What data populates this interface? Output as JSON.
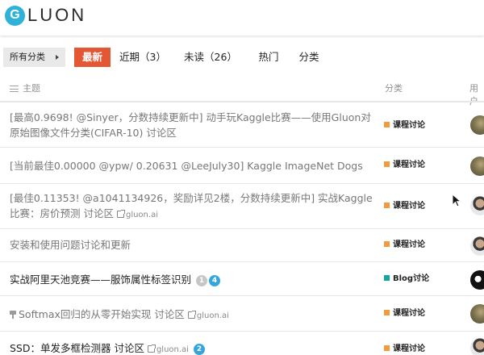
{
  "brand": {
    "logo_letter": "G",
    "logo_text": "LUON"
  },
  "nav": {
    "category_dropdown": "所有分类",
    "tabs": [
      {
        "label": "最新",
        "active": true
      },
      {
        "label": "近期（3）",
        "active": false
      },
      {
        "label": "未读（26）",
        "active": false
      },
      {
        "label": "热门",
        "active": false
      },
      {
        "label": "分类",
        "active": false
      }
    ]
  },
  "table": {
    "headers": {
      "topic": "主题",
      "category": "分类",
      "users": "用户"
    },
    "rows": [
      {
        "title": "[最高0.9698! @Sinyer，分数持续更新中] 动手玩Kaggle比赛——使用Gluon对原始图像文件分类(CIFAR-10) 讨论区",
        "unread": false,
        "category": "课程讨论",
        "category_color": "#f19a3e",
        "avatar": "olive"
      },
      {
        "title": "[当前最佳0.00000 @ypw/ 0.20631 @LeeJuly30] Kaggle ImageNet Dogs",
        "unread": false,
        "category": "课程讨论",
        "category_color": "#f19a3e",
        "avatar": "olive"
      },
      {
        "title": "[最佳0.11353! @a1041134926，奖励详见2楼，分数持续更新中] 实战Kaggle比赛：房价预测 讨论区",
        "ext_link": "gluon.ai",
        "unread": false,
        "category": "课程讨论",
        "category_color": "#f19a3e",
        "avatar": "person"
      },
      {
        "title": "安装和使用问题讨论和更新",
        "unread": false,
        "category": "课程讨论",
        "category_color": "#f19a3e",
        "avatar": "person"
      },
      {
        "title": "实战阿里天池竞赛——服饰属性标签识别",
        "badges": [
          {
            "value": "1",
            "color": "grey"
          },
          {
            "value": "4",
            "color": "blue"
          }
        ],
        "unread": true,
        "category": "Blog讨论",
        "category_color": "#12a89d",
        "avatar": "dark"
      },
      {
        "title": "Softmax回归的从零开始实现 讨论区",
        "ext_link": "gluon.ai",
        "pinned": true,
        "unread": false,
        "category": "课程讨论",
        "category_color": "#f19a3e",
        "avatar": "olive"
      },
      {
        "title": "SSD：单发多框检测器 讨论区",
        "ext_link": "gluon.ai",
        "badges": [
          {
            "value": "2",
            "color": "blue"
          }
        ],
        "unread": true,
        "category": "课程讨论",
        "category_color": "#f19a3e",
        "avatar": "person"
      }
    ]
  }
}
